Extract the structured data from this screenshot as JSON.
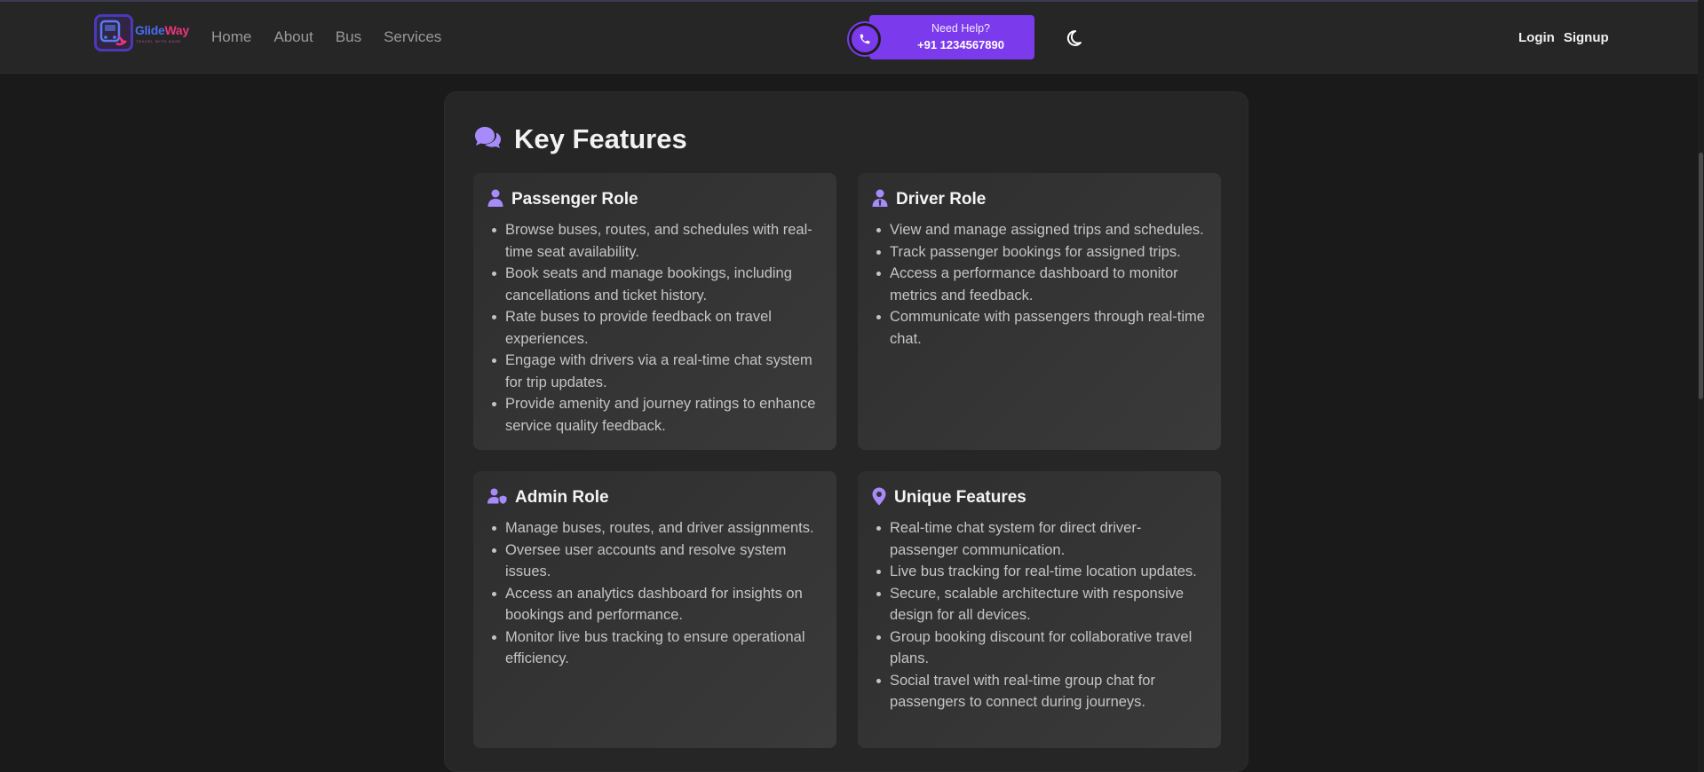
{
  "brand": {
    "name_part1": "Glide",
    "name_part2": "Way",
    "tagline": "TRAVEL WITH EASE"
  },
  "nav": {
    "links": [
      "Home",
      "About",
      "Bus",
      "Services"
    ]
  },
  "help": {
    "line1": "Need Help?",
    "line2": "+91 1234567890"
  },
  "auth": {
    "login": "Login",
    "signup": "Signup"
  },
  "colors": {
    "accent": "#7c3aed",
    "icon_accent": "#a78bfa",
    "background": "#1a1a1a",
    "card": "#333333"
  },
  "features": {
    "title": "Key Features",
    "title_icon": "comments-icon",
    "cards": [
      {
        "title": "Passenger Role",
        "icon": "user-icon",
        "items": [
          "Browse buses, routes, and schedules with real-time seat availability.",
          "Book seats and manage bookings, including cancellations and ticket history.",
          "Rate buses to provide feedback on travel experiences.",
          "Engage with drivers via a real-time chat system for trip updates.",
          "Provide amenity and journey ratings to enhance service quality feedback."
        ]
      },
      {
        "title": "Driver Role",
        "icon": "user-tie-icon",
        "items": [
          "View and manage assigned trips and schedules.",
          "Track passenger bookings for assigned trips.",
          "Access a performance dashboard to monitor metrics and feedback.",
          "Communicate with passengers through real-time chat."
        ]
      },
      {
        "title": "Admin Role",
        "icon": "user-shield-icon",
        "items": [
          "Manage buses, routes, and driver assignments.",
          "Oversee user accounts and resolve system issues.",
          "Access an analytics dashboard for insights on bookings and performance.",
          "Monitor live bus tracking to ensure operational efficiency."
        ]
      },
      {
        "title": "Unique Features",
        "icon": "map-pin-icon",
        "items": [
          "Real-time chat system for direct driver-passenger communication.",
          "Live bus tracking for real-time location updates.",
          "Secure, scalable architecture with responsive design for all devices.",
          "Group booking discount for collaborative travel plans.",
          "Social travel with real-time group chat for passengers to connect during journeys."
        ]
      }
    ]
  }
}
